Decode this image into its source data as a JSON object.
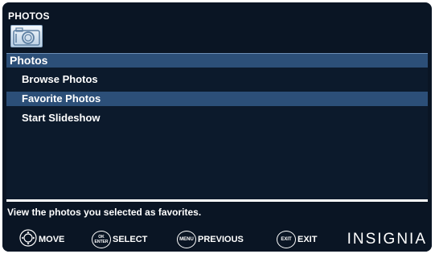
{
  "header": {
    "title": "PHOTOS",
    "icon": "camera-icon"
  },
  "menu": {
    "heading": "Photos",
    "items": [
      {
        "label": "Browse Photos",
        "selected": false
      },
      {
        "label": "Favorite Photos",
        "selected": true
      },
      {
        "label": "Start Slideshow",
        "selected": false
      }
    ]
  },
  "description": "View the photos you selected as favorites.",
  "footer": {
    "move": {
      "label": "MOVE",
      "icon": "dpad-icon"
    },
    "select": {
      "label": "SELECT",
      "key_top": "OK",
      "key_bottom": "ENTER"
    },
    "previous": {
      "label": "PREVIOUS",
      "key": "MENU"
    },
    "exit": {
      "label": "EXIT",
      "key": "EXIT"
    },
    "brand": "INSIGNIA"
  },
  "colors": {
    "background": "#0a1524",
    "highlight": "#2c4f78",
    "text": "#ffffff"
  }
}
